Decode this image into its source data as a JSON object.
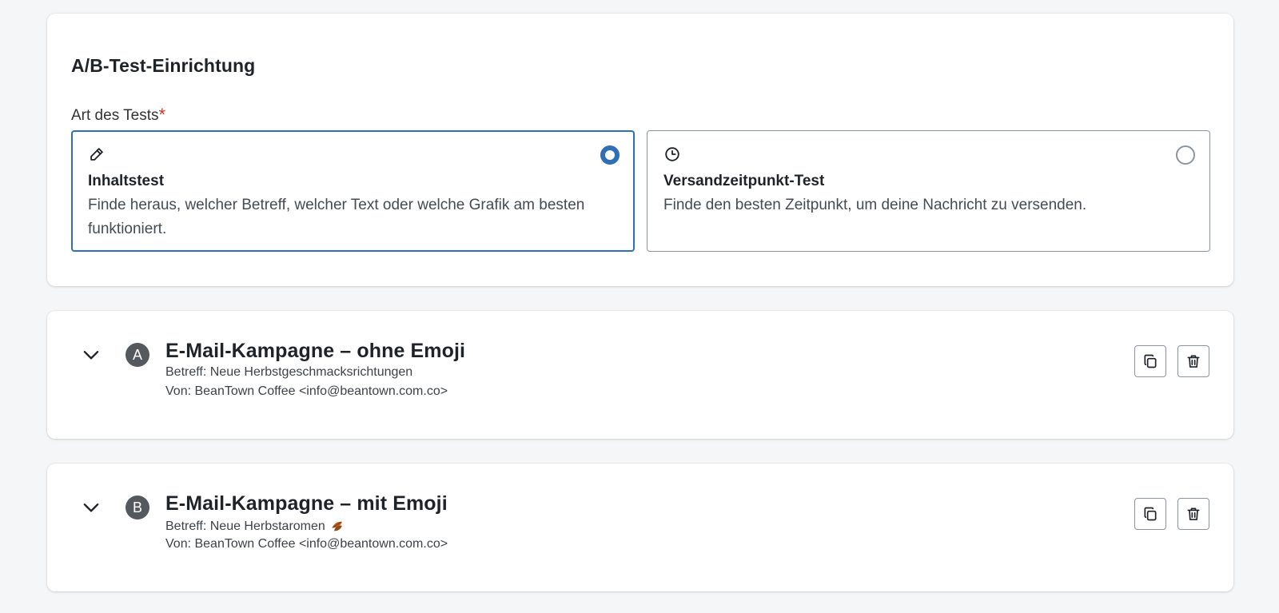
{
  "setup": {
    "title": "A/B-Test-Einrichtung",
    "field_label": "Art des Tests",
    "required_mark": "*",
    "options": [
      {
        "icon": "pencil-icon",
        "title": "Inhaltstest",
        "description": "Finde heraus, welcher Betreff, welcher Text oder welche Grafik am besten funktioniert.",
        "selected": true
      },
      {
        "icon": "clock-icon",
        "title": "Versandzeitpunkt-Test",
        "description": "Finde den besten Zeitpunkt, um deine Nachricht zu versenden.",
        "selected": false
      }
    ]
  },
  "variants": [
    {
      "letter": "A",
      "title": "E-Mail-Kampagne – ohne Emoji",
      "subject": "Betreff: Neue Herbstgeschmacksrichtungen",
      "from": "Von: BeanTown Coffee <info@beantown.com.co>"
    },
    {
      "letter": "B",
      "title": "E-Mail-Kampagne – mit Emoji",
      "subject": "Betreff: Neue Herbstaromen",
      "subject_emoji": "leaves-icon",
      "from": "Von: BeanTown Coffee <info@beantown.com.co>"
    }
  ],
  "icons": {
    "collapse": "chevron-down-icon",
    "duplicate": "copy-icon",
    "delete": "trash-icon"
  },
  "colors": {
    "accent": "#2e6fb5",
    "required": "#d4351c",
    "badge": "#54595f"
  }
}
